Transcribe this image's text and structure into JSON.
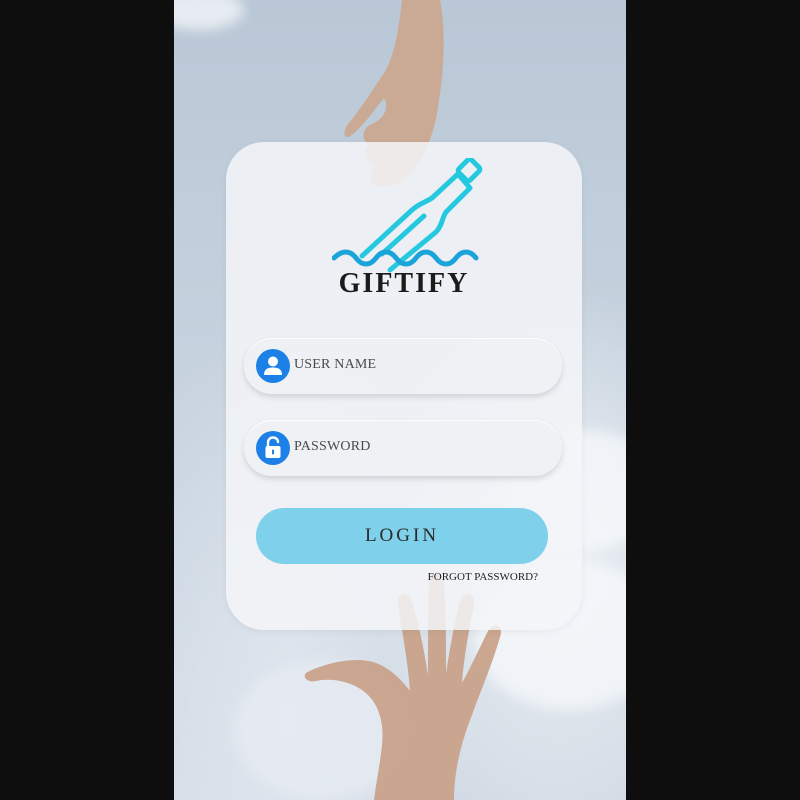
{
  "app": {
    "name": "GIFTIFY"
  },
  "login_form": {
    "username_label": "USER NAME",
    "password_label": "PASSWORD",
    "login_button": "LOGIN",
    "forgot_password": "FORGOT PASSWORD?"
  },
  "icons": {
    "logo": "message-bottle-waves-icon",
    "username": "user-icon",
    "password": "unlock-icon"
  },
  "colors": {
    "accent_cyan": "#25c9df",
    "icon_blue": "#1c80e6",
    "login_button": "#7fd0ea"
  }
}
